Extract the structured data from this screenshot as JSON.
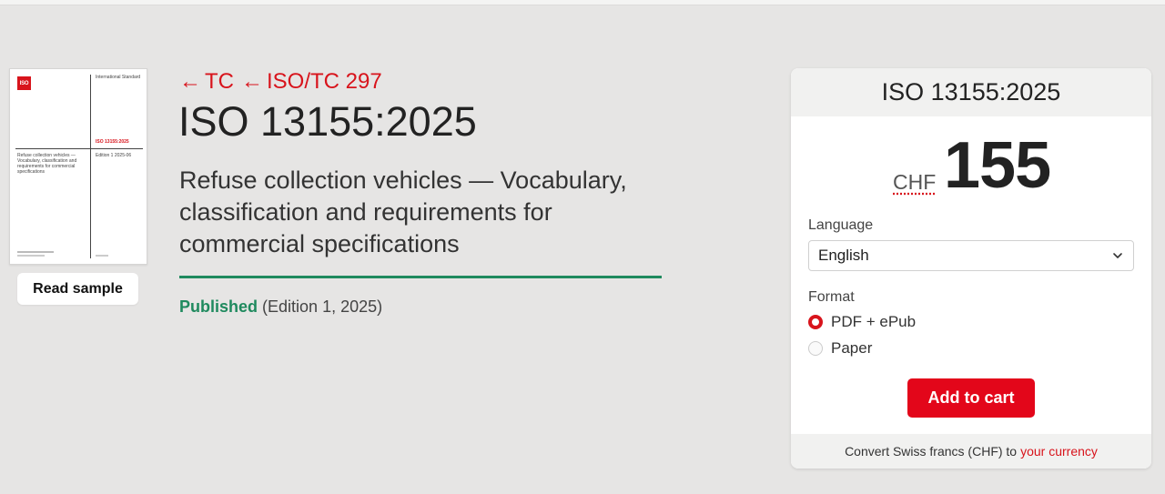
{
  "cover": {
    "logo_text": "ISO",
    "standard_type": "International Standard",
    "standard_number": "ISO 13155:2025",
    "title": "Refuse collection vehicles — Vocabulary, classification and requirements for commercial specifications",
    "edition": "Edition 1 2025-06"
  },
  "read_sample_label": "Read sample",
  "breadcrumb": {
    "items": [
      {
        "arrow": "←",
        "label": "TC"
      },
      {
        "arrow": "←",
        "label": "ISO/TC 297"
      }
    ]
  },
  "main": {
    "title": "ISO 13155:2025",
    "subtitle": "Refuse collection vehicles — Vocabulary, classification and requirements for commercial specifications",
    "status": "Published",
    "edition_info": "(Edition 1, 2025)"
  },
  "purchase": {
    "header": "ISO 13155:2025",
    "currency": "CHF",
    "price": "155",
    "language_label": "Language",
    "language_value": "English",
    "format_label": "Format",
    "formats": [
      {
        "label": "PDF + ePub",
        "selected": true
      },
      {
        "label": "Paper",
        "selected": false
      }
    ],
    "add_to_cart": "Add to cart",
    "footer_text": "Convert Swiss francs (CHF) to",
    "footer_link": "your currency"
  },
  "colors": {
    "accent_red": "#d8141c",
    "published_green": "#1f8a5e",
    "background": "#e6e5e4"
  },
  "icons": {
    "language_select": "chevron-down-icon"
  }
}
